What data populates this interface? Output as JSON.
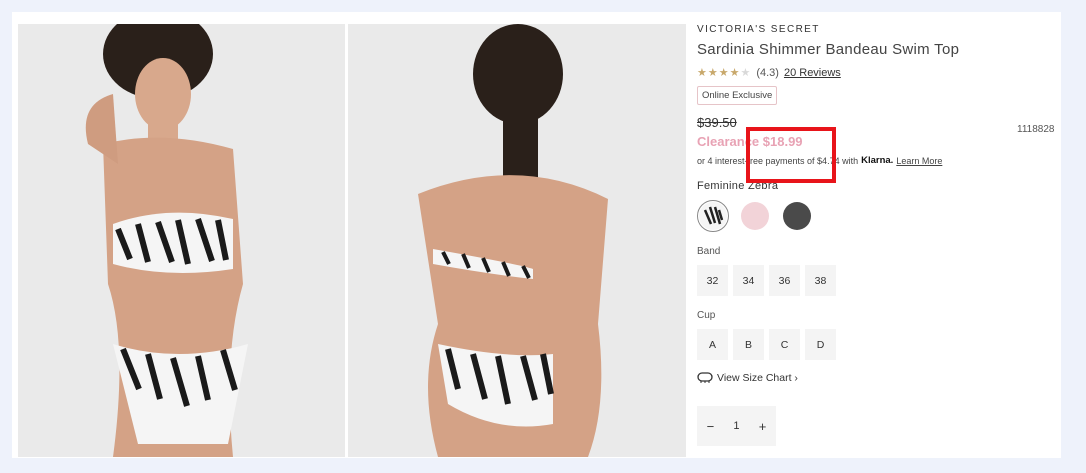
{
  "product": {
    "brand": "VICTORIA'S SECRET",
    "title": "Sardinia Shimmer Bandeau Swim Top",
    "rating_value": "(4.3)",
    "reviews_link": "20 Reviews",
    "badge": "Online Exclusive",
    "original_price": "$39.50",
    "sku": "1118828",
    "clearance_price": "Clearance $18.99",
    "klarna_text": "or 4 interest-free payments of $4.74 with",
    "klarna_brand": "Klarna.",
    "klarna_learn_more": "Learn More",
    "color_selected": "Feminine Zebra",
    "swatch_colors": [
      "#ffffff",
      "#f2d3d8",
      "#4a4a4a"
    ],
    "band_label": "Band",
    "band_sizes": [
      "32",
      "34",
      "36",
      "38"
    ],
    "cup_label": "Cup",
    "cup_sizes": [
      "A",
      "B",
      "C",
      "D"
    ],
    "size_chart_link": "View Size Chart ›",
    "qty_minus": "−",
    "qty_value": "1",
    "qty_plus": "+"
  },
  "colors": {
    "clearance": "#e8a2b4",
    "highlight": "#e8141a",
    "star": "#c8a86b"
  }
}
